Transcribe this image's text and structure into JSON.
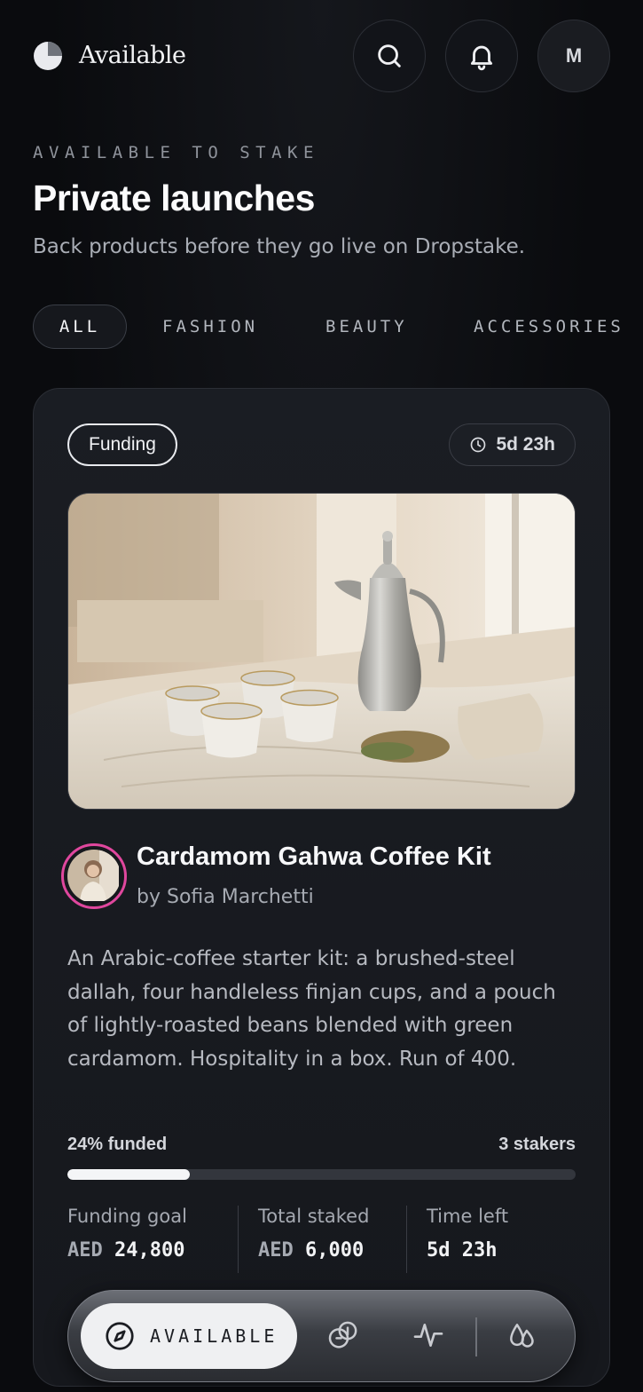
{
  "header": {
    "brand": "Available",
    "avatar_initial": "M",
    "icons": [
      "search-icon",
      "bell-icon"
    ]
  },
  "intro": {
    "eyebrow": "AVAILABLE TO STAKE",
    "title": "Private launches",
    "subtitle": "Back products before they go live on Dropstake."
  },
  "filters": [
    "ALL",
    "FASHION",
    "BEAUTY",
    "ACCESSORIES"
  ],
  "filters_active": "ALL",
  "card": {
    "status": "Funding",
    "time_pill": "5d 23h",
    "title": "Cardamom Gahwa Coffee Kit",
    "byline": "by Sofia Marchetti",
    "description": "An Arabic-coffee starter kit: a brushed-steel dallah, four handleless finjan cups, and a pouch of lightly-roasted beans blended with green cardamom. Hospitality in a box. Run of 400.",
    "funded_label": "24% funded",
    "funded_fraction": 0.24,
    "stakers": "3 stakers",
    "stats": [
      {
        "label": "Funding goal",
        "currency": "AED",
        "amount": "24,800"
      },
      {
        "label": "Total staked",
        "currency": "AED",
        "amount": "6,000"
      },
      {
        "label": "Time left",
        "currency": "",
        "amount": "5d 23h"
      }
    ]
  },
  "nav": {
    "active_label": "AVAILABLE",
    "icons": [
      "compass-icon",
      "coins-icon",
      "activity-icon",
      "drops-icon"
    ]
  },
  "colors": {
    "background": "#0a0b0e",
    "card": "#1a1d23",
    "accent_ring": "#e0479e",
    "progress_fill": "#f4f5f7"
  }
}
